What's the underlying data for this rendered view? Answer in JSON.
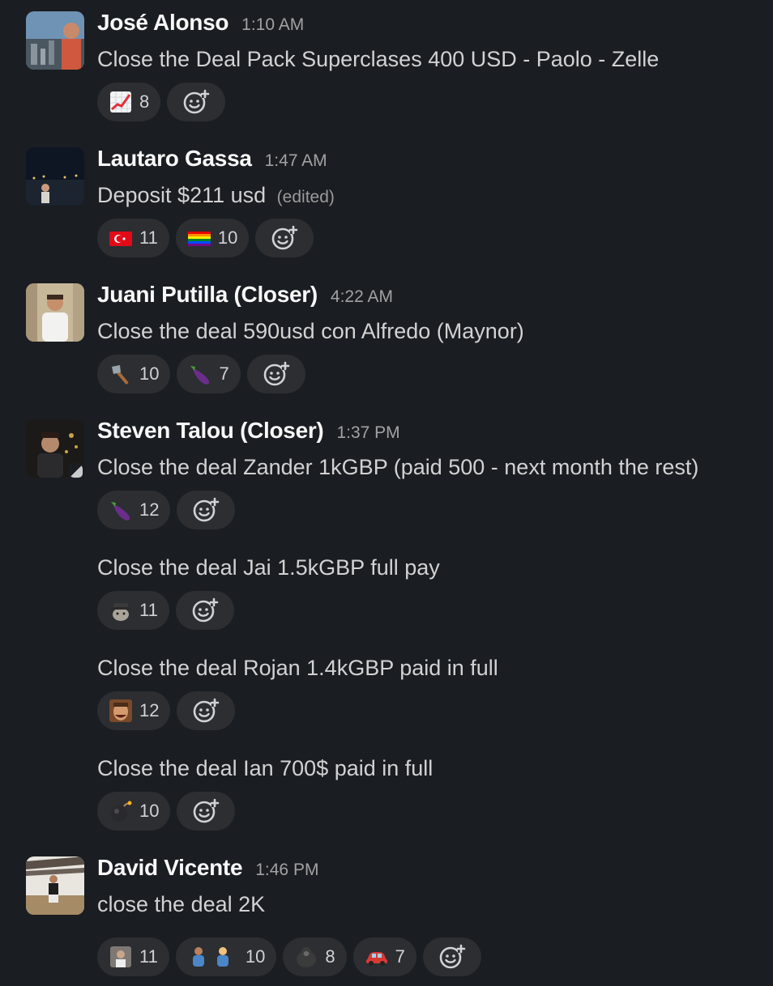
{
  "messages": [
    {
      "author": "José Alonso",
      "time": "1:10 AM",
      "text": "Close the Deal Pack Superclases 400 USD - Paolo - Zelle",
      "reactions": [
        {
          "icon": "chart-increasing-icon",
          "count": "8"
        }
      ]
    },
    {
      "author": "Lautaro Gassa",
      "time": "1:47 AM",
      "text": "Deposit $211 usd",
      "edited": "(edited)",
      "reactions": [
        {
          "icon": "flag-turkey-icon",
          "count": "11"
        },
        {
          "icon": "rainbow-flag-icon",
          "count": "10"
        }
      ]
    },
    {
      "author": "Juani Putilla (Closer)",
      "time": "4:22 AM",
      "text": "Close the deal 590usd con Alfredo (Maynor)",
      "reactions": [
        {
          "icon": "axe-icon",
          "count": "10"
        },
        {
          "icon": "eggplant-icon",
          "count": "7"
        }
      ]
    },
    {
      "author": "Steven Talou (Closer)",
      "time": "1:37 PM",
      "text": "Close the deal Zander 1kGBP (paid 500 - next month the rest)",
      "reactions": [
        {
          "icon": "eggplant-icon",
          "count": "12"
        }
      ],
      "continuations": [
        {
          "text": "Close the deal Jai 1.5kGBP full pay",
          "reactions": [
            {
              "icon": "detective-cat-icon",
              "count": "11"
            }
          ]
        },
        {
          "text": "Close the deal Rojan 1.4kGBP paid in full",
          "reactions": [
            {
              "icon": "laughing-man-icon",
              "count": "12"
            }
          ]
        },
        {
          "text": "Close the deal Ian 700$ paid in full",
          "reactions": [
            {
              "icon": "bomb-icon",
              "count": "10"
            }
          ]
        }
      ]
    },
    {
      "author": "David Vicente",
      "time": "1:46 PM",
      "text": "close the deal 2K",
      "reactions": [
        {
          "icon": "person-photo-icon",
          "count": "11"
        },
        {
          "icon": "two-men-icon",
          "count": "10"
        },
        {
          "icon": "gorilla-icon",
          "count": "8"
        },
        {
          "icon": "car-icon",
          "count": "7"
        }
      ]
    }
  ],
  "colors": {
    "background": "#1a1d21",
    "pill": "#2c2e32",
    "author": "#f8f8f8",
    "text": "#d1d2d3",
    "muted": "#a1a2a3"
  }
}
